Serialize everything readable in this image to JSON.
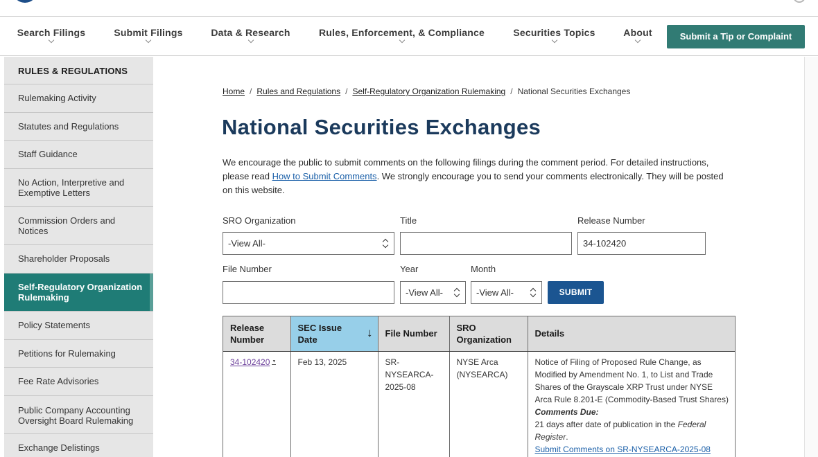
{
  "nav": {
    "items": [
      "Search Filings",
      "Submit Filings",
      "Data & Research",
      "Rules, Enforcement, & Compliance",
      "Securities Topics",
      "About"
    ],
    "tip_button": "Submit a Tip or Complaint"
  },
  "sidebar": {
    "heading": "RULES & REGULATIONS",
    "items": [
      {
        "label": "Rulemaking Activity"
      },
      {
        "label": "Statutes and Regulations"
      },
      {
        "label": "Staff Guidance"
      },
      {
        "label": "No Action, Interpretive and Exemptive Letters"
      },
      {
        "label": "Commission Orders and Notices"
      },
      {
        "label": "Shareholder Proposals"
      },
      {
        "label": "Self-Regulatory Organization Rulemaking",
        "active": true
      },
      {
        "label": "Policy Statements"
      },
      {
        "label": "Petitions for Rulemaking"
      },
      {
        "label": "Fee Rate Advisories"
      },
      {
        "label": "Public Company Accounting Oversight Board Rulemaking"
      },
      {
        "label": "Exchange Delistings"
      }
    ]
  },
  "breadcrumb": {
    "home": "Home",
    "rules": "Rules and Regulations",
    "sro": "Self-Regulatory Organization Rulemaking",
    "current": "National Securities Exchanges",
    "separator": "/"
  },
  "page": {
    "title": "National Securities Exchanges",
    "intro_before": "We encourage the public to submit comments on the following filings during the comment period. For detailed instructions, please read ",
    "intro_link": "How to Submit Comments",
    "intro_after": ". We strongly encourage you to send your comments electronically. They will be posted on this website."
  },
  "filters": {
    "sro_label": "SRO Organization",
    "sro_value": "-View All-",
    "title_label": "Title",
    "title_value": "",
    "release_label": "Release Number",
    "release_value": "34-102420",
    "file_label": "File Number",
    "file_value": "",
    "year_label": "Year",
    "year_value": "-View All-",
    "month_label": "Month",
    "month_value": "-View All-",
    "submit_label": "SUBMIT"
  },
  "table": {
    "headers": [
      "Release Number",
      "SEC Issue Date",
      "File Number",
      "SRO Organization",
      "Details"
    ],
    "sort_arrow": "↓",
    "rows": [
      {
        "release": "34-102420",
        "date": "Feb 13, 2025",
        "file": "SR-NYSEARCA-2025-08",
        "sro": "NYSE Arca (NYSEARCA)",
        "details": "Notice of Filing of Proposed Rule Change, as Modified by Amendment No. 1, to List and Trade Shares of the Grayscale XRP Trust under NYSE Arca Rule 8.201-E (Commodity-Based Trust Shares)",
        "comments_due_label": "Comments Due:",
        "comments_due_before": "21 days after date of publication in the ",
        "comments_due_em": "Federal Register",
        "comments_due_after": ".",
        "submit_comments": "Submit Comments on SR-NYSEARCA-2025-08"
      }
    ]
  }
}
